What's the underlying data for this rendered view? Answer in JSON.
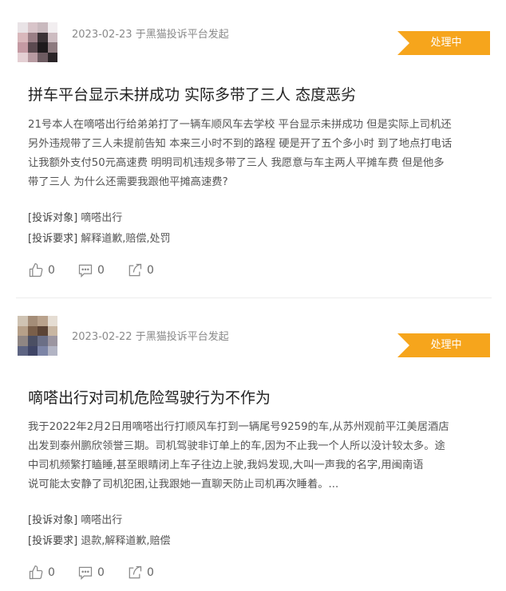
{
  "complaints": [
    {
      "date": "2023-02-23",
      "source": "于黑猫投诉平台发起",
      "status": "处理中",
      "title": "拼车平台显示未拼成功 实际多带了三人 态度恶劣",
      "body_lines": [
        "21号本人在嘀嗒出行给弟弟打了一辆车顺风车去学校 平台显示未拼成功 但是实际上司机还",
        "另外违规带了三人未提前告知 本来三小时不到的路程 硬是开了五个多小时 到了地点打电话",
        "让我额外支付50元高速费 明明司机违规多带了三人 我愿意与车主两人平摊车费 但是他多",
        "带了三人 为什么还需要我跟他平摊高速费?"
      ],
      "target_label": "[投诉对象]",
      "target_value": "嘀嗒出行",
      "demand_label": "[投诉要求]",
      "demand_value": "解释道歉,赔偿,处罚",
      "like_count": "0",
      "comment_count": "0",
      "share_count": "0"
    },
    {
      "date": "2023-02-22",
      "source": "于黑猫投诉平台发起",
      "status": "处理中",
      "title": "嘀嗒出行对司机危险驾驶行为不作为",
      "body_lines": [
        "我于2022年2月2日用嘀嗒出行打顺风车打到一辆尾号9259的车,从苏州观前平江美居酒店",
        "出发到泰州鹏欣领誉三期。司机驾驶非订单上的车,因为不止我一个人所以没计较太多。途",
        "中司机频繁打瞌睡,甚至眼睛闭上车子往边上驶,我妈发现,大叫一声我的名字,用闽南语",
        "说可能太安静了司机犯困,让我跟她一直聊天防止司机再次睡着。..."
      ],
      "target_label": "[投诉对象]",
      "target_value": "嘀嗒出行",
      "demand_label": "[投诉要求]",
      "demand_value": "退款,解释道歉,赔偿",
      "like_count": "0",
      "comment_count": "0",
      "share_count": "0"
    }
  ],
  "icons": {
    "like": "thumbs-up-icon",
    "comment": "comment-icon",
    "share": "share-icon"
  },
  "colors": {
    "status_badge": "#f6a51c",
    "meta_text": "#8a8a8a",
    "title_text": "#222222"
  }
}
